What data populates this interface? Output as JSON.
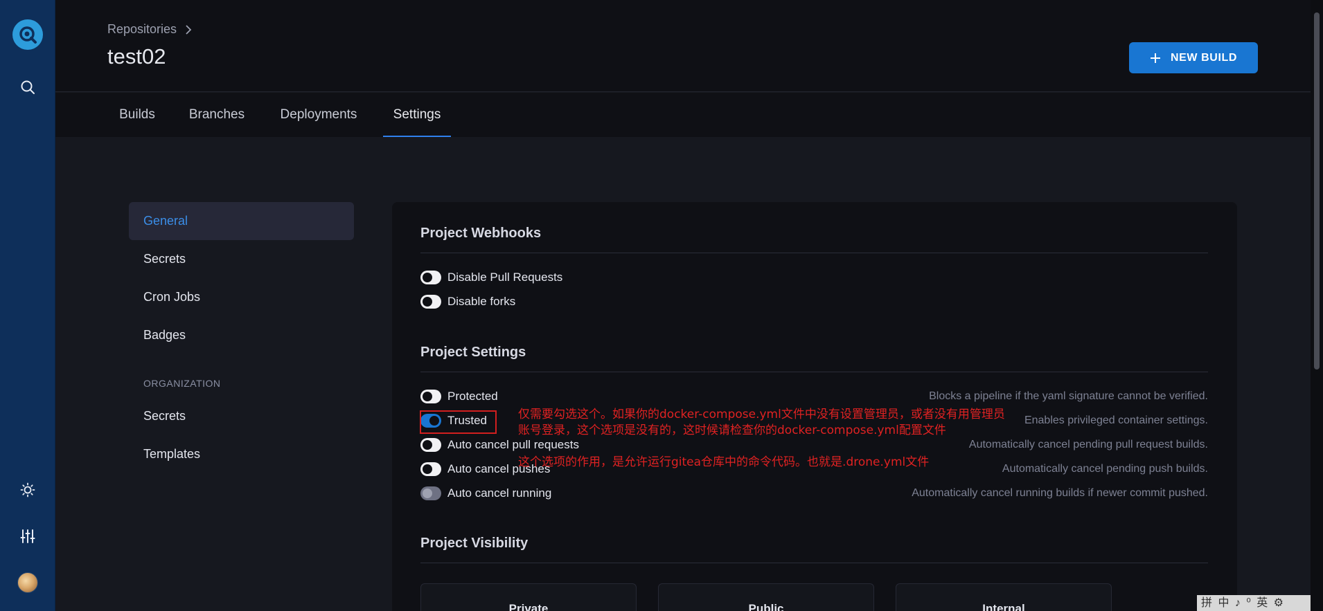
{
  "header": {
    "breadcrumb": "Repositories",
    "title": "test02",
    "new_build_label": "NEW BUILD"
  },
  "tabs": [
    {
      "label": "Builds"
    },
    {
      "label": "Branches"
    },
    {
      "label": "Deployments"
    },
    {
      "label": "Settings",
      "active": true
    }
  ],
  "settings_nav": {
    "items": [
      {
        "label": "General",
        "active": true
      },
      {
        "label": "Secrets"
      },
      {
        "label": "Cron Jobs"
      },
      {
        "label": "Badges"
      }
    ],
    "org_section": "ORGANIZATION",
    "org_items": [
      {
        "label": "Secrets"
      },
      {
        "label": "Templates"
      }
    ]
  },
  "webhooks": {
    "title": "Project Webhooks",
    "toggles": [
      {
        "label": "Disable Pull Requests",
        "state": "off"
      },
      {
        "label": "Disable forks",
        "state": "off"
      }
    ]
  },
  "project_settings": {
    "title": "Project Settings",
    "toggles": [
      {
        "label": "Protected",
        "state": "off",
        "desc": "Blocks a pipeline if the yaml signature cannot be verified."
      },
      {
        "label": "Trusted",
        "state": "on",
        "desc": "Enables privileged container settings."
      },
      {
        "label": "Auto cancel pull requests",
        "state": "off",
        "desc": "Automatically cancel pending pull request builds."
      },
      {
        "label": "Auto cancel pushes",
        "state": "off",
        "desc": "Automatically cancel pending push builds."
      },
      {
        "label": "Auto cancel running",
        "state": "disabled",
        "desc": "Automatically cancel running builds if newer commit pushed."
      }
    ]
  },
  "annotation": {
    "line1": "仅需要勾选这个。如果你的docker-compose.yml文件中没有设置管理员，或者没有用管理员",
    "line2": "账号登录，这个选项是没有的，这时候请检查你的docker-compose.yml配置文件",
    "line3": "这个选项的作用，是允许运行gitea仓库中的命令代码。也就是.drone.yml文件"
  },
  "visibility": {
    "title": "Project Visibility",
    "options": [
      {
        "label": "Private"
      },
      {
        "label": "Public"
      },
      {
        "label": "Internal"
      }
    ]
  },
  "ime_bar": "拼 中 ♪ ⁰ 英 ⚙",
  "colors": {
    "accent": "#1976d2",
    "rail": "#0e2f5a",
    "annotation": "#e02222"
  }
}
